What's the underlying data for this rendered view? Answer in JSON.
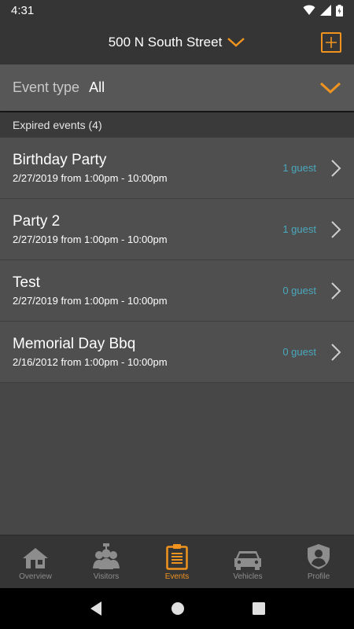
{
  "status_bar": {
    "time": "4:31"
  },
  "header": {
    "address": "500 N South Street"
  },
  "filter": {
    "label": "Event type",
    "value": "All"
  },
  "section": {
    "title": "Expired events (4)"
  },
  "events": [
    {
      "title": "Birthday Party",
      "date": "2/27/2019 from 1:00pm - 10:00pm",
      "guests": "1 guest"
    },
    {
      "title": "Party 2",
      "date": "2/27/2019 from 1:00pm - 10:00pm",
      "guests": "1 guest"
    },
    {
      "title": "Test",
      "date": "2/27/2019 from 1:00pm - 10:00pm",
      "guests": "0 guest"
    },
    {
      "title": "Memorial Day Bbq",
      "date": "2/16/2012 from 1:00pm - 10:00pm",
      "guests": "0 guest"
    }
  ],
  "tabs": [
    {
      "label": "Overview",
      "icon": "house-icon"
    },
    {
      "label": "Visitors",
      "icon": "visitors-icon"
    },
    {
      "label": "Events",
      "icon": "clipboard-icon",
      "active": true
    },
    {
      "label": "Vehicles",
      "icon": "car-icon"
    },
    {
      "label": "Profile",
      "icon": "shield-profile-icon"
    }
  ],
  "colors": {
    "accent": "#f0931f",
    "guest_text": "#4aa8bd",
    "header_bg": "#353535",
    "row_bg": "#4f4f4f"
  }
}
